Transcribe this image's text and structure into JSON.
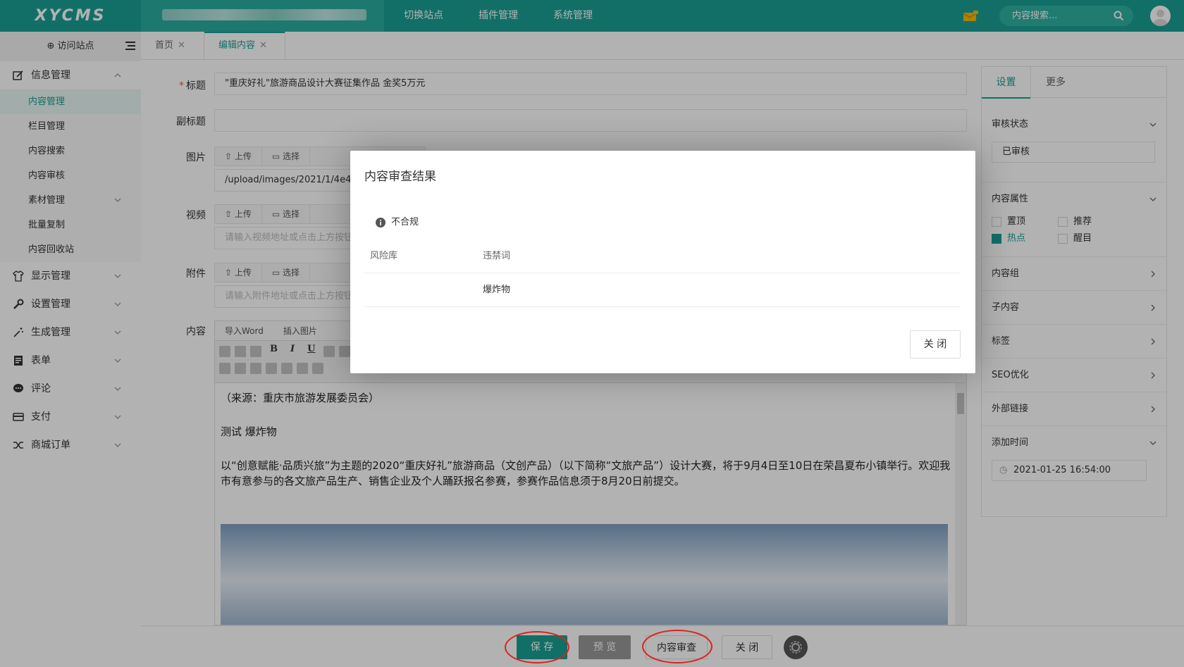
{
  "brand": "XYCMS",
  "topnav": [
    "切换站点",
    "插件管理",
    "系统管理"
  ],
  "search": {
    "placeholder": "内容搜索..."
  },
  "sidebar": {
    "visit": "访问站点",
    "groups": [
      {
        "label": "信息管理",
        "icon": "edit-icon"
      },
      {
        "label": "显示管理",
        "icon": "shirt-icon"
      },
      {
        "label": "设置管理",
        "icon": "wrench-icon"
      },
      {
        "label": "生成管理",
        "icon": "magic-wand-icon"
      },
      {
        "label": "表单",
        "icon": "form-icon"
      },
      {
        "label": "评论",
        "icon": "comment-icon"
      },
      {
        "label": "支付",
        "icon": "card-icon"
      },
      {
        "label": "商城订单",
        "icon": "shuffle-icon"
      }
    ],
    "subitems": [
      "内容管理",
      "栏目管理",
      "内容搜索",
      "内容审核",
      "素材管理",
      "批量复制",
      "内容回收站"
    ]
  },
  "tabs": [
    {
      "label": "首页"
    },
    {
      "label": "编辑内容"
    }
  ],
  "form": {
    "title_label": "标题",
    "title_value": "\"重庆好礼\"旅游商品设计大赛征集作品 金奖5万元",
    "subtitle_label": "副标题",
    "image_label": "图片",
    "image_path": "/upload/images/2021/1/4e47c4",
    "video_label": "视频",
    "video_placeholder": "请输入视频地址或点击上方按钮",
    "attach_label": "附件",
    "attach_placeholder": "请输入附件地址或点击上方按钮",
    "content_label": "内容",
    "upload": "上传",
    "choose": "选择",
    "editor_tabs": [
      "导入Word",
      "插入图片"
    ],
    "body": [
      "（来源：重庆市旅游发展委员会）",
      "测试 爆炸物",
      "以“创意赋能·品质兴旅”为主题的2020“重庆好礼”旅游商品（文创产品）（以下简称“文旅产品”）设计大赛，将于9月4日至10日在荣昌夏布小镇举行。欢迎我市有意参与的各文旅产品生产、销售企业及个人踊跃报名参赛，参赛作品信息须于8月20日前提交。"
    ]
  },
  "rightpanel": {
    "tabs": [
      "设置",
      "更多"
    ],
    "audit_label": "审核状态",
    "audit_value": "已审核",
    "attr_label": "内容属性",
    "attrs": [
      {
        "label": "置顶",
        "checked": false
      },
      {
        "label": "推荐",
        "checked": false
      },
      {
        "label": "热点",
        "checked": true
      },
      {
        "label": "醒目",
        "checked": false
      }
    ],
    "sections": [
      "内容组",
      "子内容",
      "标签",
      "SEO优化",
      "外部链接"
    ],
    "time_label": "添加时间",
    "time_value": "2021-01-25 16:54:00"
  },
  "bottom": {
    "save": "保 存",
    "preview": "预 览",
    "audit": "内容审查",
    "close": "关 闭"
  },
  "modal": {
    "title": "内容审查结果",
    "verdict": "不合规",
    "col1": "风险库",
    "col2": "违禁词",
    "rows": [
      {
        "library": "",
        "word": "爆炸物"
      }
    ],
    "close": "关 闭"
  },
  "colors": {
    "brand": "#1aa094",
    "highlight_ring": "#e0201c"
  }
}
